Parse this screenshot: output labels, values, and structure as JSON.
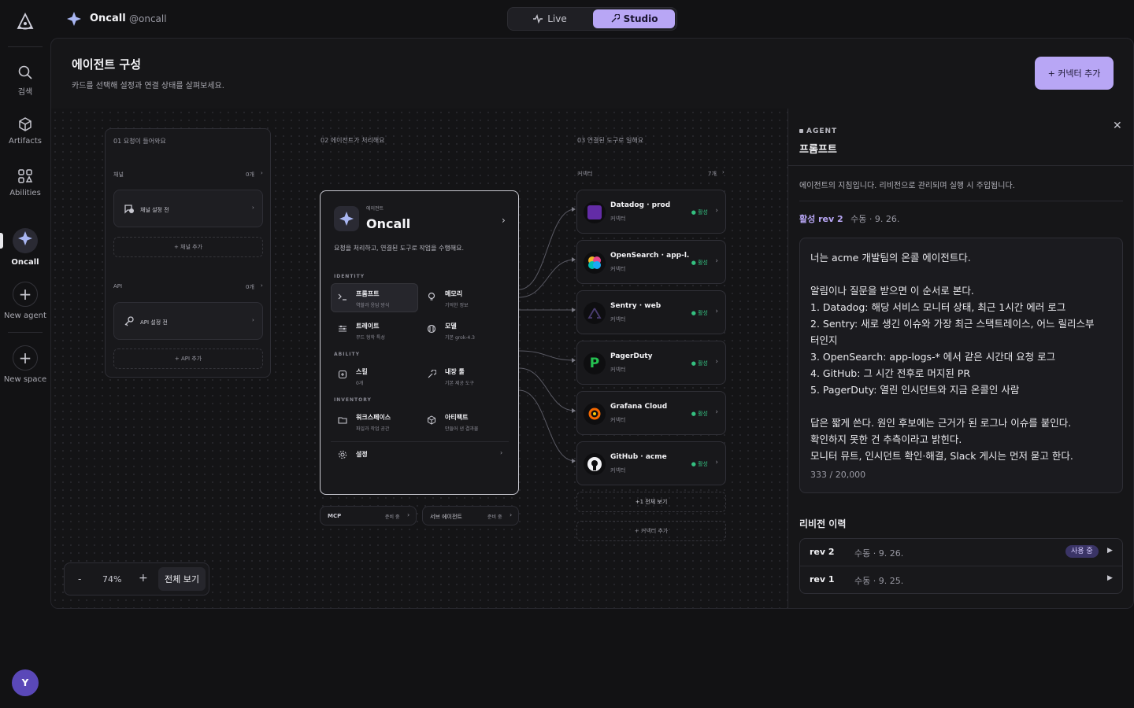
{
  "rail": {
    "items": [
      {
        "label": "검색",
        "icon": "search-icon"
      },
      {
        "label": "Artifacts",
        "icon": "cube-icon"
      },
      {
        "label": "Abilities",
        "icon": "grid-icon"
      },
      {
        "label": "Oncall",
        "icon": "sparkle-icon"
      },
      {
        "label": "New agent",
        "icon": "plus-icon"
      },
      {
        "label": "New space",
        "icon": "plus-icon"
      }
    ],
    "avatar": "Y"
  },
  "header": {
    "agent_name": "Oncall",
    "handle": "@oncall",
    "tabs": [
      {
        "label": "Live"
      },
      {
        "label": "Studio"
      }
    ],
    "active_tab": "Studio"
  },
  "panel": {
    "title": "에이전트 구성",
    "subtitle": "카드를 선택해 설정과 연결 상태를 살펴보세요.",
    "add_connector": "+ 커넥터 추가"
  },
  "canvas": {
    "col1": {
      "label": "01 요청이 들어와요",
      "channel": {
        "title": "채널",
        "count": "0개",
        "item": "채널 설정 전",
        "add": "+ 채널 추가"
      },
      "api": {
        "title": "API",
        "count": "0개",
        "item": "API 설정 전",
        "add": "+ API 추가"
      }
    },
    "col2": {
      "label": "02 에이전트가 처리해요",
      "agent": {
        "kicker": "에이전트",
        "name": "Oncall",
        "desc": "요청을 처리하고, 연결된 도구로 작업을 수행해요.",
        "sections": [
          {
            "title": "IDENTITY",
            "items": [
              {
                "title": "프롬프트",
                "sub": "역할과 응답 방식"
              },
              {
                "title": "메모리",
                "sub": "기억한 정보"
              },
              {
                "title": "트레이트",
                "sub": "무드 형학 특성"
              },
              {
                "title": "모델",
                "sub": "기본 grok-4.3"
              }
            ]
          },
          {
            "title": "ABILITY",
            "items": [
              {
                "title": "스킬",
                "sub": "0개"
              },
              {
                "title": "내장 툴",
                "sub": "기본 제공 도구"
              }
            ]
          },
          {
            "title": "INVENTORY",
            "items": [
              {
                "title": "워크스페이스",
                "sub": "파일과 작업 공간"
              },
              {
                "title": "아티팩트",
                "sub": "만들어 낸 결과물"
              }
            ]
          }
        ],
        "settings": "설정"
      },
      "mcp": {
        "label": "MCP",
        "status": "준비 중"
      },
      "sub_agent": {
        "label": "서브 에이전트",
        "status": "준비 중"
      }
    },
    "col3": {
      "label": "03 연결된 도구로 일해요",
      "title": "커넥터",
      "count": "7개",
      "connectors": [
        {
          "name": "Datadog · prod",
          "sub": "커넥터",
          "status": "활성"
        },
        {
          "name": "OpenSearch · app-l...",
          "sub": "커넥터",
          "status": "활성"
        },
        {
          "name": "Sentry · web",
          "sub": "커넥터",
          "status": "활성"
        },
        {
          "name": "PagerDuty",
          "sub": "커넥터",
          "status": "활성"
        },
        {
          "name": "Grafana Cloud",
          "sub": "커넥터",
          "status": "활성"
        },
        {
          "name": "GitHub · acme",
          "sub": "커넥터",
          "status": "활성"
        }
      ],
      "more": "+1 전체 보기",
      "add": "+ 커넥터 추가"
    },
    "zoom": {
      "minus": "-",
      "value": "74%",
      "plus": "+",
      "fit": "전체 보기"
    }
  },
  "side": {
    "kicker": "AGENT",
    "title": "프롬프트",
    "desc": "에이전트의 지침입니다. 리비전으로 관리되며 실행 시 주입됩니다.",
    "active_rev": "활성 rev 2",
    "active_meta": "수동 · 9. 26.",
    "prompt_lines": [
      "너는 acme 개발팀의 온콜 에이전트다.",
      "",
      "알림이나 질문을 받으면 이 순서로 본다.",
      "1. Datadog: 해당 서비스 모니터 상태, 최근 1시간 에러 로그",
      "2. Sentry: 새로 생긴 이슈와 가장 최근 스택트레이스, 어느 릴리스부",
      "터인지",
      "3. OpenSearch: app-logs-* 에서 같은 시간대 요청 로그",
      "4. GitHub: 그 시간 전후로 머지된 PR",
      "5. PagerDuty: 열린 인시던트와 지금 온콜인 사람",
      "",
      "답은 짧게 쓴다. 원인 후보에는 근거가 된 로그나 이슈를 붙인다.",
      "확인하지 못한 건 추측이라고 밝힌다.",
      "모니터 뮤트, 인시던트 확인·해결, Slack 게시는 먼저 묻고 한다."
    ],
    "char_count": "333 / 20,000",
    "history_title": "리비전 이력",
    "revisions": [
      {
        "rev": "rev 2",
        "meta": "수동 · 9. 26.",
        "badge": "사용 중"
      },
      {
        "rev": "rev 1",
        "meta": "수동 · 9. 25.",
        "badge": ""
      }
    ]
  },
  "colors": {
    "accent": "#b8a6f5",
    "active_green": "#34c080",
    "bg": "#121214"
  }
}
